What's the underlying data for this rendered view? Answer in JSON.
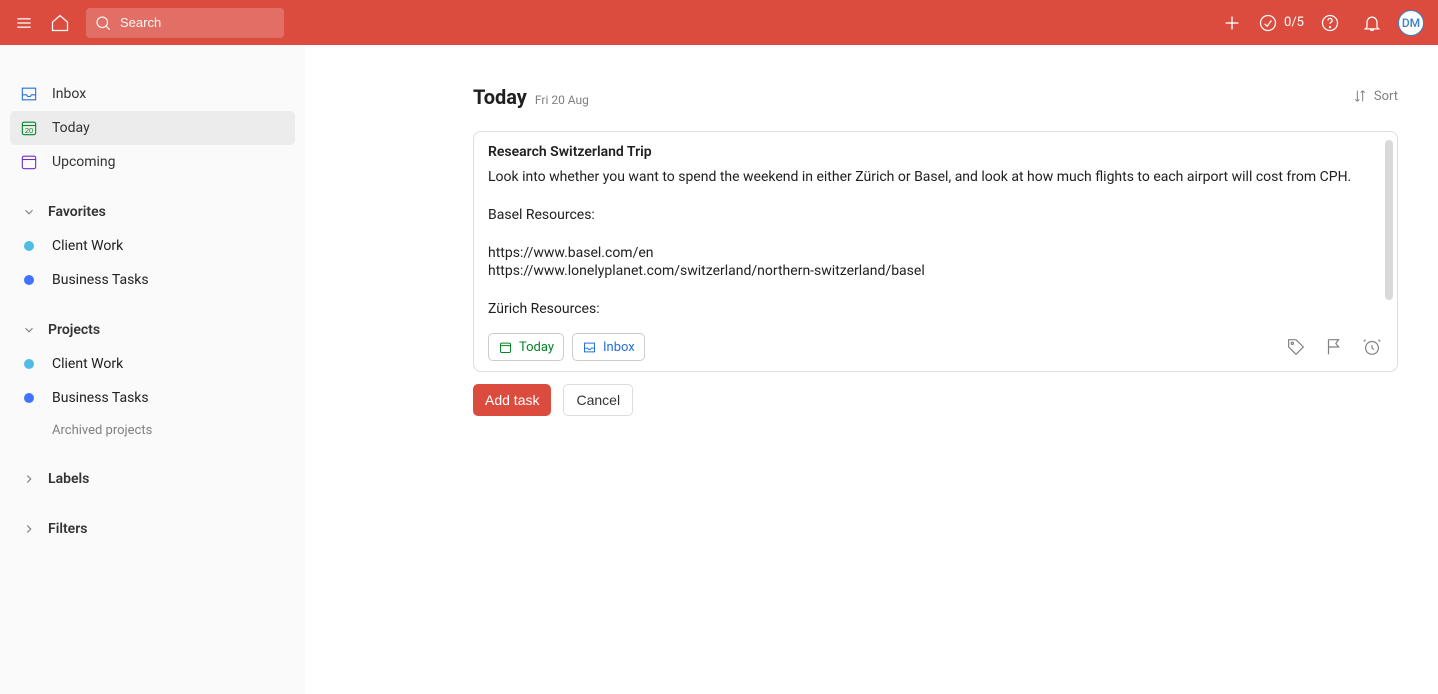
{
  "header": {
    "search_placeholder": "Search",
    "goal_count": "0/5",
    "avatar_initials": "DM"
  },
  "sidebar": {
    "nav": {
      "inbox": "Inbox",
      "today": "Today",
      "today_number": "20",
      "upcoming": "Upcoming"
    },
    "favorites_label": "Favorites",
    "favorites": [
      {
        "name": "Client Work",
        "color": "#4fbde3"
      },
      {
        "name": "Business Tasks",
        "color": "#4073ff"
      }
    ],
    "projects_label": "Projects",
    "projects": [
      {
        "name": "Client Work",
        "color": "#4fbde3"
      },
      {
        "name": "Business Tasks",
        "color": "#4073ff"
      }
    ],
    "archived_label": "Archived projects",
    "labels_label": "Labels",
    "filters_label": "Filters"
  },
  "page": {
    "title": "Today",
    "date": "Fri 20 Aug",
    "sort_label": "Sort"
  },
  "task": {
    "title": "Research Switzerland Trip",
    "description": "Look into whether you want to spend the weekend in either Zürich or Basel, and look at how much flights to each airport will cost from CPH.\n\nBasel Resources:\n\nhttps://www.basel.com/en\nhttps://www.lonelyplanet.com/switzerland/northern-switzerland/basel\n\nZürich Resources:",
    "schedule_label": "Today",
    "project_label": "Inbox"
  },
  "actions": {
    "add": "Add task",
    "cancel": "Cancel"
  }
}
